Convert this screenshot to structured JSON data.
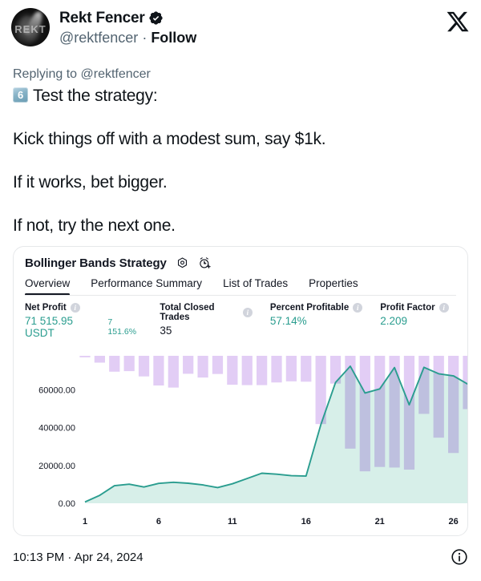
{
  "tweet": {
    "display_name": "Rekt Fencer",
    "verified_icon": "verified-badge-icon",
    "handle": "@rektfencer",
    "separator": "·",
    "follow_label": "Follow",
    "avatar_text": "REKT",
    "x_logo_icon": "x-logo-icon",
    "replying_to": "Replying to @rektfencer",
    "emoji_number": "6",
    "line1": "Test the strategy:",
    "line2": "Kick things off with a modest sum, say $1k.",
    "line3": "If it works, bet bigger.",
    "line4": "If not, try the next one.",
    "timestamp": "10:13 PM · Apr 24, 2024",
    "info_icon": "info-circle-icon"
  },
  "card": {
    "title": "Bollinger Bands Strategy",
    "icons": [
      "strategy-settings-icon",
      "alert-clock-add-icon"
    ],
    "tabs": [
      {
        "label": "Overview",
        "active": true
      },
      {
        "label": "Performance Summary",
        "active": false
      },
      {
        "label": "List of Trades",
        "active": false
      },
      {
        "label": "Properties",
        "active": false
      }
    ],
    "stats": [
      {
        "label": "Net Profit",
        "value": "71 515.95 USDT",
        "sub": "7 151.6%",
        "positive": true
      },
      {
        "label": "Total Closed Trades",
        "value": "35",
        "sub": "",
        "positive": false
      },
      {
        "label": "Percent Profitable",
        "value": "57.14%",
        "sub": "",
        "positive": true
      },
      {
        "label": "Profit Factor",
        "value": "2.209",
        "sub": "",
        "positive": true
      }
    ]
  },
  "colors": {
    "equity_line": "#2a9d8f",
    "equity_fill": "#d7efe9",
    "drawdown_bar": "#e2cdf5",
    "drawdown_bar_overlap": "#b3aee0",
    "accent_text": "#2a9d8f",
    "tab_active": "#131722",
    "card_border": "#e6e8ea"
  },
  "chart_data": {
    "type": "area",
    "title": "Bollinger Bands Strategy — Overview",
    "xlabel": "",
    "ylabel": "",
    "xlim": [
      1,
      27
    ],
    "ylim": [
      0,
      78000
    ],
    "yticks": [
      0,
      20000,
      40000,
      60000
    ],
    "ytick_labels": [
      "0.00",
      "20000.00",
      "40000.00",
      "60000.00"
    ],
    "xticks": [
      1,
      6,
      11,
      16,
      21,
      26
    ],
    "xtick_labels": [
      "1",
      "6",
      "11",
      "16",
      "21",
      "26"
    ],
    "grid": false,
    "legend": false,
    "x": [
      1,
      2,
      3,
      4,
      5,
      6,
      7,
      8,
      9,
      10,
      11,
      12,
      13,
      14,
      15,
      16,
      17,
      18,
      19,
      20,
      21,
      22,
      23,
      24,
      25,
      26,
      27
    ],
    "series": [
      {
        "name": "Equity",
        "type": "area",
        "color": "#2a9d8f",
        "fill": "#d7efe9",
        "values": [
          700,
          4200,
          9300,
          10100,
          8600,
          10500,
          11100,
          10600,
          9700,
          8300,
          10300,
          13100,
          15900,
          15400,
          14600,
          14400,
          41500,
          63900,
          72500,
          58300,
          60500,
          71800,
          52100,
          71900,
          68500,
          67400,
          62900
        ]
      },
      {
        "name": "Drawdown",
        "type": "bar",
        "color": "#e2cdf5",
        "note": "bars hang downward from the chart top; values are bar depth in price units",
        "top_value": 78000,
        "bottom_values": [
          77200,
          74400,
          69600,
          69900,
          67100,
          62300,
          61200,
          68500,
          66500,
          68400,
          62700,
          62500,
          62500,
          63900,
          64500,
          64300,
          41900,
          63300,
          28900,
          16900,
          19200,
          18900,
          17800,
          47300,
          34700,
          26600,
          49800
        ]
      }
    ]
  }
}
